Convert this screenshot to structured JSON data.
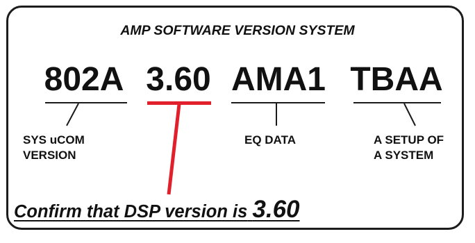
{
  "title": "AMP SOFTWARE VERSION SYSTEM",
  "codes": [
    "802A",
    "3.60",
    "AMA1",
    "TBAA"
  ],
  "labels": {
    "sys_ucom": [
      "SYS uCOM",
      "VERSION"
    ],
    "eq_data": [
      "EQ DATA"
    ],
    "setup": [
      "A SETUP OF",
      "A SYSTEM"
    ]
  },
  "confirm": {
    "text": "Confirm that DSP version is",
    "version": "3.60"
  },
  "colors": {
    "highlight": "#e2202c",
    "ink": "#111111",
    "border": "#1c1c1c"
  }
}
